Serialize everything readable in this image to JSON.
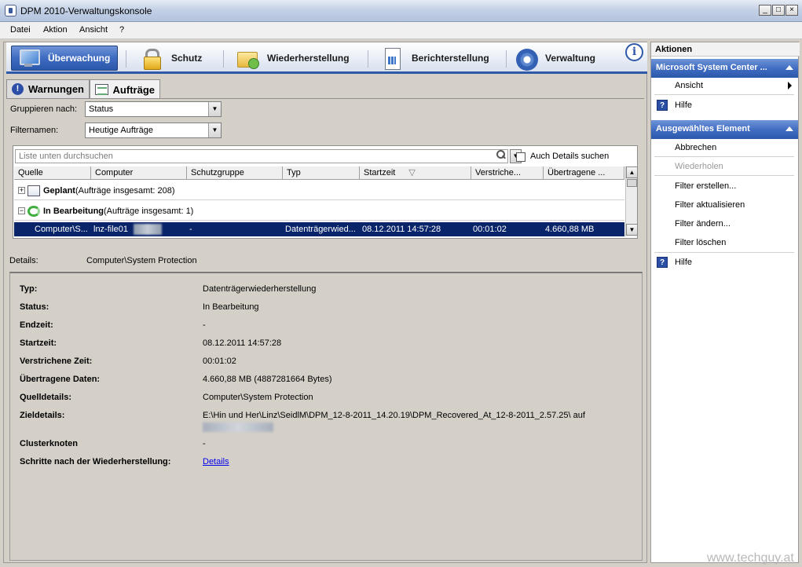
{
  "window": {
    "title": "DPM 2010-Verwaltungskonsole",
    "controls": [
      "_",
      "□",
      "×"
    ]
  },
  "menu": [
    "Datei",
    "Aktion",
    "Ansicht",
    "?"
  ],
  "ribbon": {
    "tabs": [
      {
        "label": "Überwachung",
        "icon": "monitor-icon",
        "active": true
      },
      {
        "label": "Schutz",
        "icon": "lock-icon"
      },
      {
        "label": "Wiederherstellung",
        "icon": "folder-recover-icon"
      },
      {
        "label": "Berichterstellung",
        "icon": "report-icon"
      },
      {
        "label": "Verwaltung",
        "icon": "gear-icon"
      }
    ],
    "info_icon": "i"
  },
  "subtabs": [
    {
      "label": "Warnungen",
      "icon": "warning-icon"
    },
    {
      "label": "Aufträge",
      "icon": "jobs-icon",
      "active": true
    }
  ],
  "filters": {
    "group_by_label": "Gruppieren nach:",
    "group_by_value": "Status",
    "filter_label": "Filternamen:",
    "filter_value": "Heutige Aufträge",
    "search_placeholder": "Liste unten durchsuchen",
    "details_search_label": "Auch Details suchen"
  },
  "grid": {
    "columns": [
      "Quelle",
      "Computer",
      "Schutzgruppe",
      "Typ",
      "Startzeit",
      "Verstriche...",
      "Übertragene ..."
    ],
    "sort_indicator": "▽",
    "groups": [
      {
        "expander": "+",
        "name": "Geplant",
        "count_text": " (Aufträge insgesamt: 208)",
        "icon": "scheduled-icon"
      },
      {
        "expander": "−",
        "name": "In Bearbeitung",
        "count_text": " (Aufträge insgesamt: 1)",
        "icon": "in-progress-icon"
      }
    ],
    "selected_row": {
      "source": "Computer\\S...",
      "computer": "lnz-file01",
      "protection_group": "-",
      "type": "Datenträgerwied...",
      "start": "08.12.2011 14:57:28",
      "elapsed": "00:01:02",
      "transferred": "4.660,88 MB"
    }
  },
  "details_header": {
    "label": "Details:",
    "value": "Computer\\System Protection"
  },
  "details": [
    {
      "label": "Typ:",
      "value": "Datenträgerwiederherstellung"
    },
    {
      "label": "Status:",
      "value": "In Bearbeitung"
    },
    {
      "label": "Endzeit:",
      "value": "-"
    },
    {
      "label": "Startzeit:",
      "value": "08.12.2011 14:57:28"
    },
    {
      "label": "Verstrichene Zeit:",
      "value": "00:01:02"
    },
    {
      "label": "Übertragene Daten:",
      "value": "4.660,88 MB (4887281664 Bytes)"
    },
    {
      "label": "Quelldetails:",
      "value": "Computer\\System Protection"
    },
    {
      "label": "Zieldetails:",
      "value": "E:\\Hin und Her\\Linz\\SeidlM\\DPM_12-8-2011_14.20.19\\DPM_Recovered_At_12-8-2011_2.57.25\\  auf"
    },
    {
      "label": "Clusterknoten",
      "value": "-"
    },
    {
      "label": "Schritte nach der Wiederherstellung:",
      "value": "Details"
    }
  ],
  "actions": {
    "title": "Aktionen",
    "sections": [
      {
        "header": "Microsoft System Center ...",
        "items": [
          "Ansicht",
          "Hilfe"
        ]
      },
      {
        "header": "Ausgewähltes Element",
        "items": [
          "Abbrechen",
          "Wiederholen",
          "Filter erstellen...",
          "Filter aktualisieren",
          "Filter ändern...",
          "Filter löschen",
          "Hilfe"
        ]
      }
    ],
    "help_glyph": "?"
  },
  "watermark": "www.techguy.at"
}
